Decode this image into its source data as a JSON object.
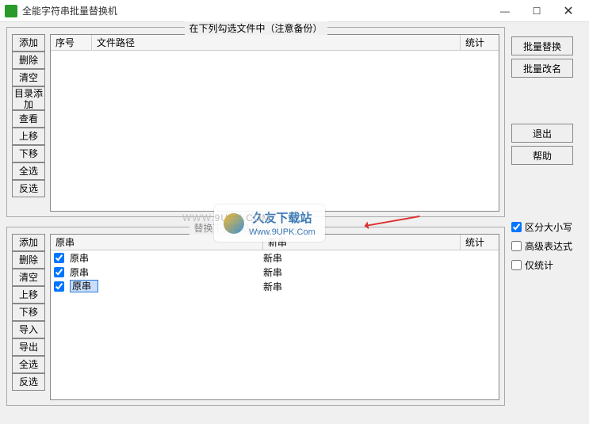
{
  "titlebar": {
    "title": "全能字符串批量替换机"
  },
  "group_files": {
    "label": "在下列勾选文件中（注意备份）",
    "buttons": {
      "add": "添加",
      "delete": "删除",
      "clear": "清空",
      "dir_add": "目录添加",
      "view": "查看",
      "move_up": "上移",
      "move_down": "下移",
      "select_all": "全选",
      "invert": "反选"
    },
    "columns": {
      "index": "序号",
      "path": "文件路径",
      "stats": "统计"
    }
  },
  "group_replace": {
    "label": "替换下列勾选项（谨慎操作）",
    "buttons": {
      "add": "添加",
      "delete": "删除",
      "clear": "清空",
      "move_up": "上移",
      "move_down": "下移",
      "import": "导入",
      "export": "导出",
      "select_all": "全选",
      "invert": "反选"
    },
    "columns": {
      "old": "原串",
      "new": "新串",
      "stats": "统计"
    },
    "rows": [
      {
        "checked": true,
        "old": "原串",
        "new": "新串",
        "editing": false
      },
      {
        "checked": true,
        "old": "原串",
        "new": "新串",
        "editing": false
      },
      {
        "checked": true,
        "old": "原串",
        "new": "新串",
        "editing": true
      }
    ]
  },
  "right_buttons": {
    "batch_replace": "批量替换",
    "batch_rename": "批量改名",
    "exit": "退出",
    "help": "帮助"
  },
  "options": {
    "case_sensitive": {
      "label": "区分大小写",
      "checked": true
    },
    "advanced_regex": {
      "label": "高级表达式",
      "checked": false
    },
    "stats_only": {
      "label": "仅统计",
      "checked": false
    }
  },
  "watermark": {
    "faint": "WWW.9UPK.COM",
    "cn": "久友下载站",
    "en": "Www.9UPK.Com"
  }
}
